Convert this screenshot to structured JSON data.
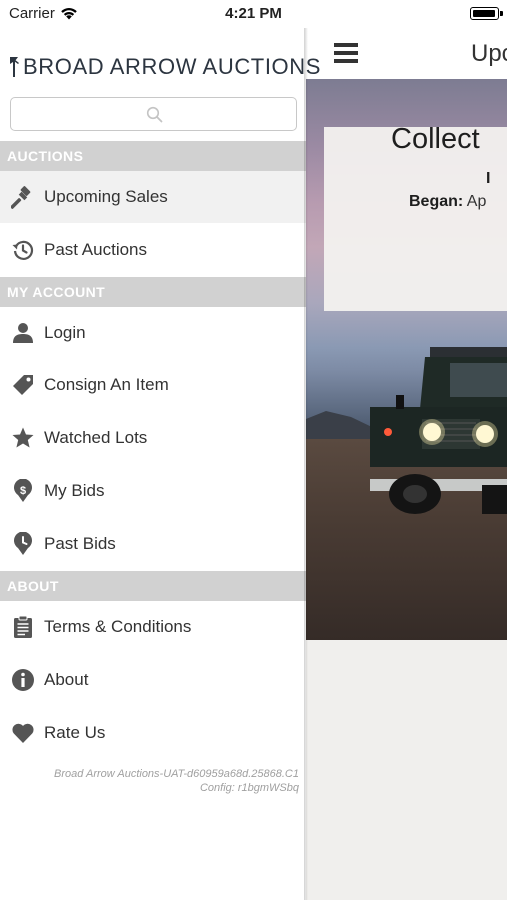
{
  "status_bar": {
    "carrier": "Carrier",
    "time": "4:21 PM"
  },
  "drawer": {
    "brand": "BROAD ARROW AUCTIONS",
    "search": {
      "placeholder": "",
      "value": ""
    },
    "sections": [
      {
        "header": "AUCTIONS",
        "items": [
          {
            "label": "Upcoming Sales",
            "icon": "gavel-icon",
            "selected": true
          },
          {
            "label": "Past Auctions",
            "icon": "history-icon",
            "selected": false
          }
        ]
      },
      {
        "header": "MY ACCOUNT",
        "items": [
          {
            "label": "Login",
            "icon": "person-icon"
          },
          {
            "label": "Consign An Item",
            "icon": "tag-icon"
          },
          {
            "label": "Watched Lots",
            "icon": "star-icon"
          },
          {
            "label": "My Bids",
            "icon": "dollar-pin-icon"
          },
          {
            "label": "Past Bids",
            "icon": "clock-pin-icon"
          }
        ]
      },
      {
        "header": "ABOUT",
        "items": [
          {
            "label": "Terms & Conditions",
            "icon": "clipboard-icon"
          },
          {
            "label": "About",
            "icon": "info-icon"
          },
          {
            "label": "Rate Us",
            "icon": "heart-icon"
          }
        ]
      }
    ],
    "version_line1": "Broad Arrow Auctions-UAT-d60959a68d.25868.C1",
    "version_line2": "Config: r1bgmWSbq"
  },
  "content": {
    "nav_title": "Upc",
    "sale_card": {
      "title": "Collect",
      "subtitle": "I",
      "began_label": "Began:",
      "began_value": "Ap"
    }
  },
  "colors": {
    "section_header_bg": "#d1d1d1",
    "selected_row_bg": "#f1f1f1",
    "brand_text": "#2c3540",
    "icon": "#555555"
  }
}
